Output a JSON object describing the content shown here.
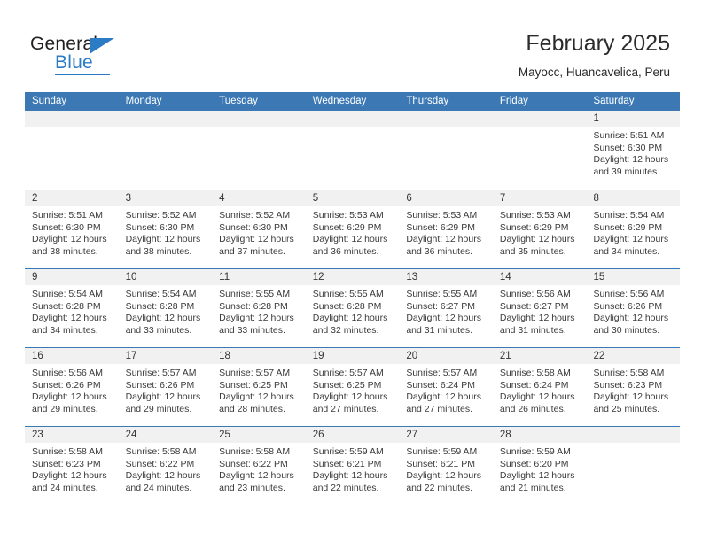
{
  "brand": {
    "name_top": "General",
    "name_bottom": "Blue"
  },
  "header": {
    "title": "February 2025",
    "subtitle": "Mayocc, Huancavelica, Peru"
  },
  "colors": {
    "header_blue": "#3c79b4",
    "brand_blue": "#2b7cc4",
    "date_band": "#f1f1f1"
  },
  "calendar": {
    "day_headers": [
      "Sunday",
      "Monday",
      "Tuesday",
      "Wednesday",
      "Thursday",
      "Friday",
      "Saturday"
    ],
    "weeks": [
      [
        {
          "date": "",
          "sunrise": "",
          "sunset": "",
          "daylight_line1": "",
          "daylight_line2": ""
        },
        {
          "date": "",
          "sunrise": "",
          "sunset": "",
          "daylight_line1": "",
          "daylight_line2": ""
        },
        {
          "date": "",
          "sunrise": "",
          "sunset": "",
          "daylight_line1": "",
          "daylight_line2": ""
        },
        {
          "date": "",
          "sunrise": "",
          "sunset": "",
          "daylight_line1": "",
          "daylight_line2": ""
        },
        {
          "date": "",
          "sunrise": "",
          "sunset": "",
          "daylight_line1": "",
          "daylight_line2": ""
        },
        {
          "date": "",
          "sunrise": "",
          "sunset": "",
          "daylight_line1": "",
          "daylight_line2": ""
        },
        {
          "date": "1",
          "sunrise": "Sunrise: 5:51 AM",
          "sunset": "Sunset: 6:30 PM",
          "daylight_line1": "Daylight: 12 hours",
          "daylight_line2": "and 39 minutes."
        }
      ],
      [
        {
          "date": "2",
          "sunrise": "Sunrise: 5:51 AM",
          "sunset": "Sunset: 6:30 PM",
          "daylight_line1": "Daylight: 12 hours",
          "daylight_line2": "and 38 minutes."
        },
        {
          "date": "3",
          "sunrise": "Sunrise: 5:52 AM",
          "sunset": "Sunset: 6:30 PM",
          "daylight_line1": "Daylight: 12 hours",
          "daylight_line2": "and 38 minutes."
        },
        {
          "date": "4",
          "sunrise": "Sunrise: 5:52 AM",
          "sunset": "Sunset: 6:30 PM",
          "daylight_line1": "Daylight: 12 hours",
          "daylight_line2": "and 37 minutes."
        },
        {
          "date": "5",
          "sunrise": "Sunrise: 5:53 AM",
          "sunset": "Sunset: 6:29 PM",
          "daylight_line1": "Daylight: 12 hours",
          "daylight_line2": "and 36 minutes."
        },
        {
          "date": "6",
          "sunrise": "Sunrise: 5:53 AM",
          "sunset": "Sunset: 6:29 PM",
          "daylight_line1": "Daylight: 12 hours",
          "daylight_line2": "and 36 minutes."
        },
        {
          "date": "7",
          "sunrise": "Sunrise: 5:53 AM",
          "sunset": "Sunset: 6:29 PM",
          "daylight_line1": "Daylight: 12 hours",
          "daylight_line2": "and 35 minutes."
        },
        {
          "date": "8",
          "sunrise": "Sunrise: 5:54 AM",
          "sunset": "Sunset: 6:29 PM",
          "daylight_line1": "Daylight: 12 hours",
          "daylight_line2": "and 34 minutes."
        }
      ],
      [
        {
          "date": "9",
          "sunrise": "Sunrise: 5:54 AM",
          "sunset": "Sunset: 6:28 PM",
          "daylight_line1": "Daylight: 12 hours",
          "daylight_line2": "and 34 minutes."
        },
        {
          "date": "10",
          "sunrise": "Sunrise: 5:54 AM",
          "sunset": "Sunset: 6:28 PM",
          "daylight_line1": "Daylight: 12 hours",
          "daylight_line2": "and 33 minutes."
        },
        {
          "date": "11",
          "sunrise": "Sunrise: 5:55 AM",
          "sunset": "Sunset: 6:28 PM",
          "daylight_line1": "Daylight: 12 hours",
          "daylight_line2": "and 33 minutes."
        },
        {
          "date": "12",
          "sunrise": "Sunrise: 5:55 AM",
          "sunset": "Sunset: 6:28 PM",
          "daylight_line1": "Daylight: 12 hours",
          "daylight_line2": "and 32 minutes."
        },
        {
          "date": "13",
          "sunrise": "Sunrise: 5:55 AM",
          "sunset": "Sunset: 6:27 PM",
          "daylight_line1": "Daylight: 12 hours",
          "daylight_line2": "and 31 minutes."
        },
        {
          "date": "14",
          "sunrise": "Sunrise: 5:56 AM",
          "sunset": "Sunset: 6:27 PM",
          "daylight_line1": "Daylight: 12 hours",
          "daylight_line2": "and 31 minutes."
        },
        {
          "date": "15",
          "sunrise": "Sunrise: 5:56 AM",
          "sunset": "Sunset: 6:26 PM",
          "daylight_line1": "Daylight: 12 hours",
          "daylight_line2": "and 30 minutes."
        }
      ],
      [
        {
          "date": "16",
          "sunrise": "Sunrise: 5:56 AM",
          "sunset": "Sunset: 6:26 PM",
          "daylight_line1": "Daylight: 12 hours",
          "daylight_line2": "and 29 minutes."
        },
        {
          "date": "17",
          "sunrise": "Sunrise: 5:57 AM",
          "sunset": "Sunset: 6:26 PM",
          "daylight_line1": "Daylight: 12 hours",
          "daylight_line2": "and 29 minutes."
        },
        {
          "date": "18",
          "sunrise": "Sunrise: 5:57 AM",
          "sunset": "Sunset: 6:25 PM",
          "daylight_line1": "Daylight: 12 hours",
          "daylight_line2": "and 28 minutes."
        },
        {
          "date": "19",
          "sunrise": "Sunrise: 5:57 AM",
          "sunset": "Sunset: 6:25 PM",
          "daylight_line1": "Daylight: 12 hours",
          "daylight_line2": "and 27 minutes."
        },
        {
          "date": "20",
          "sunrise": "Sunrise: 5:57 AM",
          "sunset": "Sunset: 6:24 PM",
          "daylight_line1": "Daylight: 12 hours",
          "daylight_line2": "and 27 minutes."
        },
        {
          "date": "21",
          "sunrise": "Sunrise: 5:58 AM",
          "sunset": "Sunset: 6:24 PM",
          "daylight_line1": "Daylight: 12 hours",
          "daylight_line2": "and 26 minutes."
        },
        {
          "date": "22",
          "sunrise": "Sunrise: 5:58 AM",
          "sunset": "Sunset: 6:23 PM",
          "daylight_line1": "Daylight: 12 hours",
          "daylight_line2": "and 25 minutes."
        }
      ],
      [
        {
          "date": "23",
          "sunrise": "Sunrise: 5:58 AM",
          "sunset": "Sunset: 6:23 PM",
          "daylight_line1": "Daylight: 12 hours",
          "daylight_line2": "and 24 minutes."
        },
        {
          "date": "24",
          "sunrise": "Sunrise: 5:58 AM",
          "sunset": "Sunset: 6:22 PM",
          "daylight_line1": "Daylight: 12 hours",
          "daylight_line2": "and 24 minutes."
        },
        {
          "date": "25",
          "sunrise": "Sunrise: 5:58 AM",
          "sunset": "Sunset: 6:22 PM",
          "daylight_line1": "Daylight: 12 hours",
          "daylight_line2": "and 23 minutes."
        },
        {
          "date": "26",
          "sunrise": "Sunrise: 5:59 AM",
          "sunset": "Sunset: 6:21 PM",
          "daylight_line1": "Daylight: 12 hours",
          "daylight_line2": "and 22 minutes."
        },
        {
          "date": "27",
          "sunrise": "Sunrise: 5:59 AM",
          "sunset": "Sunset: 6:21 PM",
          "daylight_line1": "Daylight: 12 hours",
          "daylight_line2": "and 22 minutes."
        },
        {
          "date": "28",
          "sunrise": "Sunrise: 5:59 AM",
          "sunset": "Sunset: 6:20 PM",
          "daylight_line1": "Daylight: 12 hours",
          "daylight_line2": "and 21 minutes."
        },
        {
          "date": "",
          "sunrise": "",
          "sunset": "",
          "daylight_line1": "",
          "daylight_line2": ""
        }
      ]
    ]
  }
}
